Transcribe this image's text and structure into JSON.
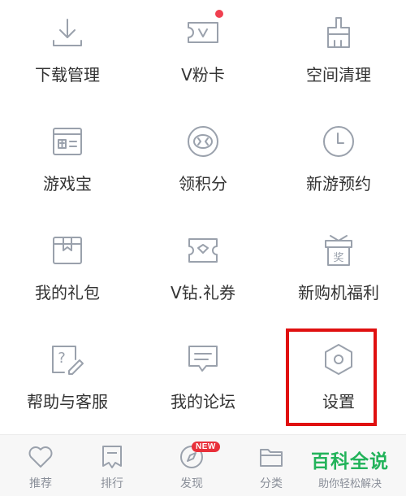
{
  "colors": {
    "icon": "#9aa1ac",
    "accent_red": "#e01010",
    "badge": "#e8303a",
    "watermark": "#22b35a"
  },
  "menu": [
    {
      "label": "下载管理",
      "icon": "download-icon"
    },
    {
      "label": "V粉卡",
      "icon": "vcard-icon",
      "has_red_dot": true
    },
    {
      "label": "空间清理",
      "icon": "broom-icon"
    },
    {
      "label": "游戏宝",
      "icon": "game-treasure-icon"
    },
    {
      "label": "领积分",
      "icon": "points-coin-icon"
    },
    {
      "label": "新游预约",
      "icon": "clock-icon"
    },
    {
      "label": "我的礼包",
      "icon": "gift-box-icon"
    },
    {
      "label": "V钻.礼券",
      "icon": "coupon-icon"
    },
    {
      "label": "新购机福利",
      "icon": "prize-icon",
      "icon_text": "奖"
    },
    {
      "label": "帮助与客服",
      "icon": "help-icon",
      "icon_text": "?"
    },
    {
      "label": "我的论坛",
      "icon": "forum-icon"
    },
    {
      "label": "设置",
      "icon": "settings-icon",
      "highlighted": true
    }
  ],
  "tabbar": [
    {
      "label": "推荐",
      "icon": "heart-icon"
    },
    {
      "label": "排行",
      "icon": "bookmark-icon"
    },
    {
      "label": "发现",
      "icon": "compass-icon",
      "badge": "NEW"
    },
    {
      "label": "分类",
      "icon": "folder-icon"
    }
  ],
  "watermark": {
    "title": "百科全说",
    "subtitle": "助你轻松解决"
  }
}
